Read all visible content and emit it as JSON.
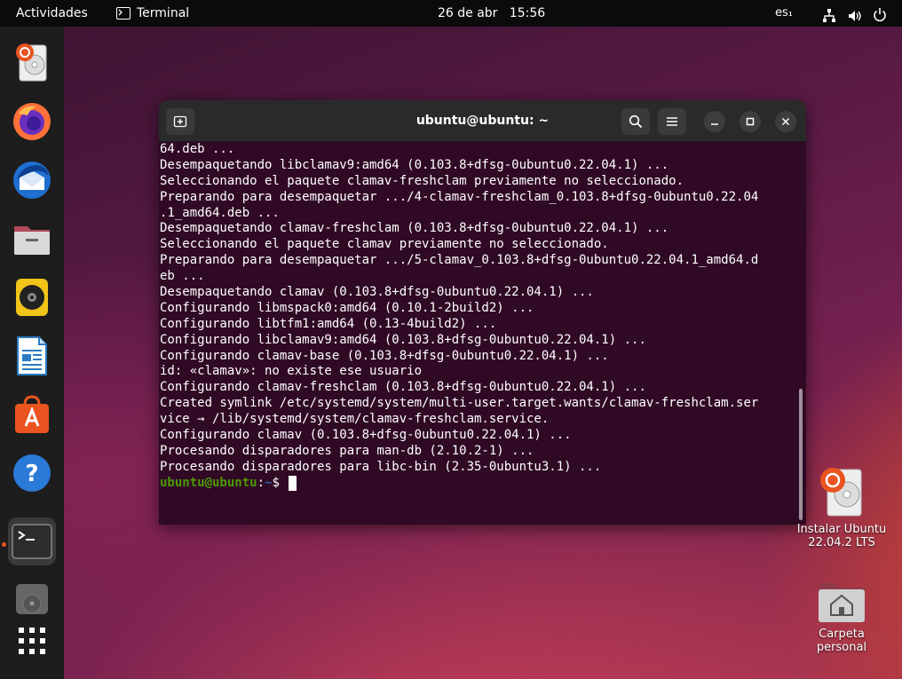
{
  "topbar": {
    "activities": "Actividades",
    "app_name": "Terminal",
    "date": "26 de abr",
    "time": "15:56",
    "keyboard": "es₁"
  },
  "dock": {
    "items": [
      {
        "icon": "ubuntu-installer-icon"
      },
      {
        "icon": "firefox-icon"
      },
      {
        "icon": "thunderbird-icon"
      },
      {
        "icon": "files-icon"
      },
      {
        "icon": "rhythmbox-icon"
      },
      {
        "icon": "libreoffice-writer-icon"
      },
      {
        "icon": "app-center-icon"
      },
      {
        "icon": "help-icon"
      },
      {
        "icon": "terminal-icon"
      },
      {
        "icon": "disk-icon"
      },
      {
        "icon": "show-apps-icon"
      }
    ]
  },
  "terminal": {
    "title": "ubuntu@ubuntu: ~",
    "lines": [
      "64.deb ...",
      "Desempaquetando libclamav9:amd64 (0.103.8+dfsg-0ubuntu0.22.04.1) ...",
      "Seleccionando el paquete clamav-freshclam previamente no seleccionado.",
      "Preparando para desempaquetar .../4-clamav-freshclam_0.103.8+dfsg-0ubuntu0.22.04",
      ".1_amd64.deb ...",
      "Desempaquetando clamav-freshclam (0.103.8+dfsg-0ubuntu0.22.04.1) ...",
      "Seleccionando el paquete clamav previamente no seleccionado.",
      "Preparando para desempaquetar .../5-clamav_0.103.8+dfsg-0ubuntu0.22.04.1_amd64.d",
      "eb ...",
      "Desempaquetando clamav (0.103.8+dfsg-0ubuntu0.22.04.1) ...",
      "Configurando libmspack0:amd64 (0.10.1-2build2) ...",
      "Configurando libtfm1:amd64 (0.13-4build2) ...",
      "Configurando libclamav9:amd64 (0.103.8+dfsg-0ubuntu0.22.04.1) ...",
      "Configurando clamav-base (0.103.8+dfsg-0ubuntu0.22.04.1) ...",
      "id: «clamav»: no existe ese usuario",
      "Configurando clamav-freshclam (0.103.8+dfsg-0ubuntu0.22.04.1) ...",
      "Created symlink /etc/systemd/system/multi-user.target.wants/clamav-freshclam.ser",
      "vice → /lib/systemd/system/clamav-freshclam.service.",
      "Configurando clamav (0.103.8+dfsg-0ubuntu0.22.04.1) ...",
      "Procesando disparadores para man-db (2.10.2-1) ...",
      "Procesando disparadores para libc-bin (2.35-0ubuntu3.1) ..."
    ],
    "prompt_user": "ubuntu@ubuntu",
    "prompt_sep": ":",
    "prompt_path": "~",
    "prompt_symbol": "$"
  },
  "desktop_icons": {
    "installer_line1": "Instalar Ubuntu",
    "installer_line2": "22.04.2 LTS",
    "home_label": "Carpeta personal"
  },
  "colors": {
    "terminal_bg": "#300a24",
    "prompt_user": "#4e9a06",
    "prompt_path": "#3465a4",
    "accent": "#e95420"
  }
}
